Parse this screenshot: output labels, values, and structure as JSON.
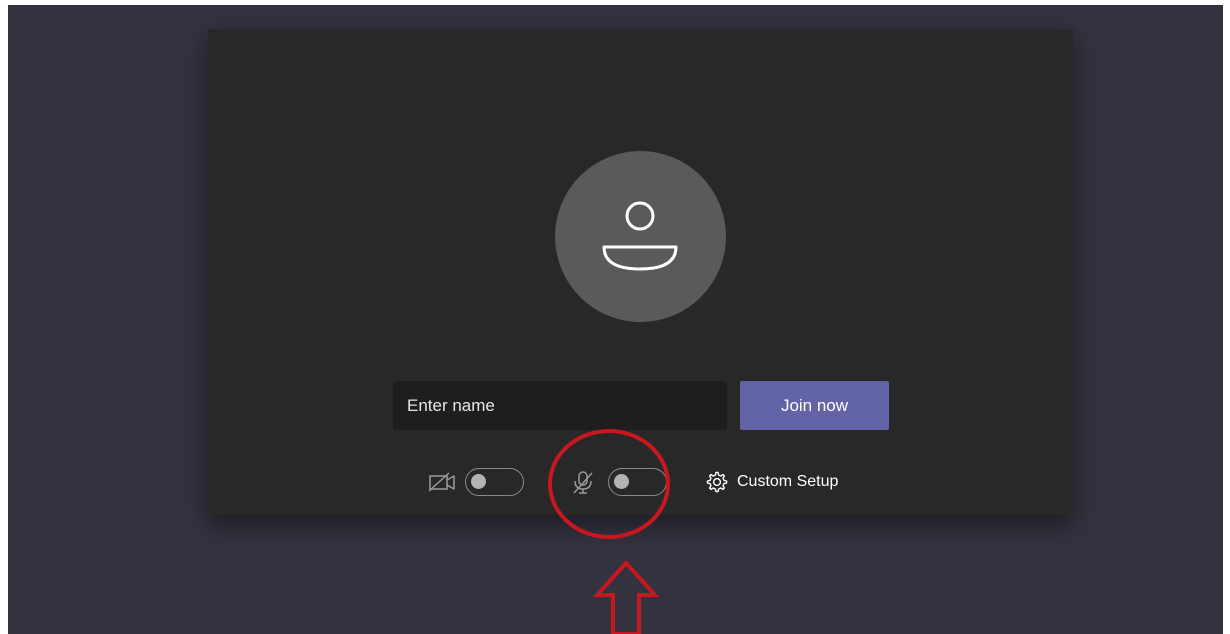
{
  "prejoin": {
    "name_placeholder": "Enter name",
    "name_value": "",
    "join_label": "Join now",
    "custom_setup_label": "Custom Setup",
    "camera_toggle_on": false,
    "mic_toggle_on": false
  },
  "icons": {
    "avatar": "person-icon",
    "camera": "camera-off-icon",
    "mic": "mic-off-icon",
    "settings": "gear-icon",
    "annotation": "up-arrow-icon"
  },
  "colors": {
    "background": "#33323f",
    "card": "#292828",
    "accent": "#6264a7",
    "annotation": "#c8171e"
  }
}
